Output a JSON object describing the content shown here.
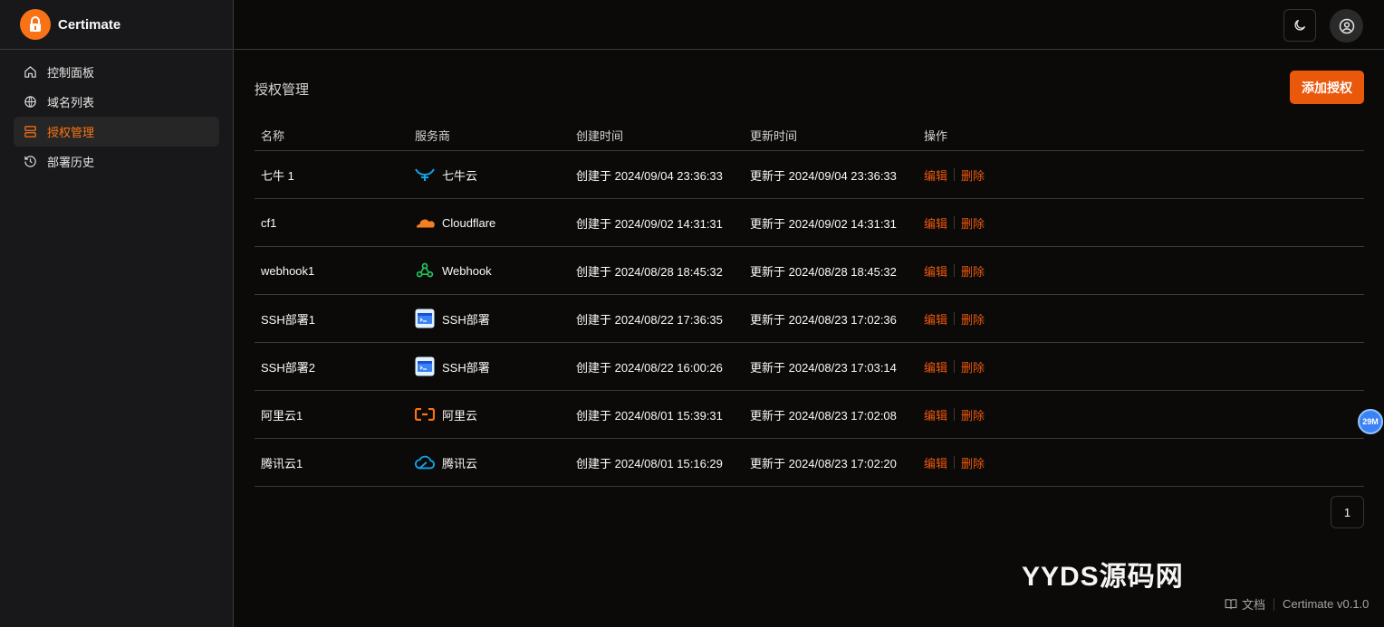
{
  "app": {
    "name": "Certimate"
  },
  "sidebar": {
    "items": [
      {
        "label": "控制面板",
        "icon": "home-icon",
        "active": false
      },
      {
        "label": "域名列表",
        "icon": "globe-icon",
        "active": false
      },
      {
        "label": "授权管理",
        "icon": "server-icon",
        "active": true
      },
      {
        "label": "部署历史",
        "icon": "history-icon",
        "active": false
      }
    ]
  },
  "page": {
    "title": "授权管理",
    "add_button": "添加授权"
  },
  "table": {
    "headers": [
      "名称",
      "服务商",
      "创建时间",
      "更新时间",
      "操作"
    ],
    "edit_label": "编辑",
    "delete_label": "删除",
    "rows": [
      {
        "name": "七牛 1",
        "provider": "七牛云",
        "provider_icon": "qiniu-icon",
        "created": "创建于 2024/09/04 23:36:33",
        "updated": "更新于 2024/09/04 23:36:33"
      },
      {
        "name": "cf1",
        "provider": "Cloudflare",
        "provider_icon": "cloudflare-icon",
        "created": "创建于 2024/09/02 14:31:31",
        "updated": "更新于 2024/09/02 14:31:31"
      },
      {
        "name": "webhook1",
        "provider": "Webhook",
        "provider_icon": "webhook-icon",
        "created": "创建于 2024/08/28 18:45:32",
        "updated": "更新于 2024/08/28 18:45:32"
      },
      {
        "name": "SSH部署1",
        "provider": "SSH部署",
        "provider_icon": "ssh-icon",
        "created": "创建于 2024/08/22 17:36:35",
        "updated": "更新于 2024/08/23 17:02:36"
      },
      {
        "name": "SSH部署2",
        "provider": "SSH部署",
        "provider_icon": "ssh-icon",
        "created": "创建于 2024/08/22 16:00:26",
        "updated": "更新于 2024/08/23 17:03:14"
      },
      {
        "name": "阿里云1",
        "provider": "阿里云",
        "provider_icon": "aliyun-icon",
        "created": "创建于 2024/08/01 15:39:31",
        "updated": "更新于 2024/08/23 17:02:08"
      },
      {
        "name": "腾讯云1",
        "provider": "腾讯云",
        "provider_icon": "tencent-cloud-icon",
        "created": "创建于 2024/08/01 15:16:29",
        "updated": "更新于 2024/08/23 17:02:20"
      }
    ]
  },
  "pagination": {
    "current": "1"
  },
  "watermark": "YYDS源码网",
  "bubble": "29M",
  "footer": {
    "docs": "文档",
    "version": "Certimate v0.1.0"
  },
  "colors": {
    "accent": "#ea580c",
    "background": "#0c0a09",
    "sidebar": "#18181a"
  }
}
